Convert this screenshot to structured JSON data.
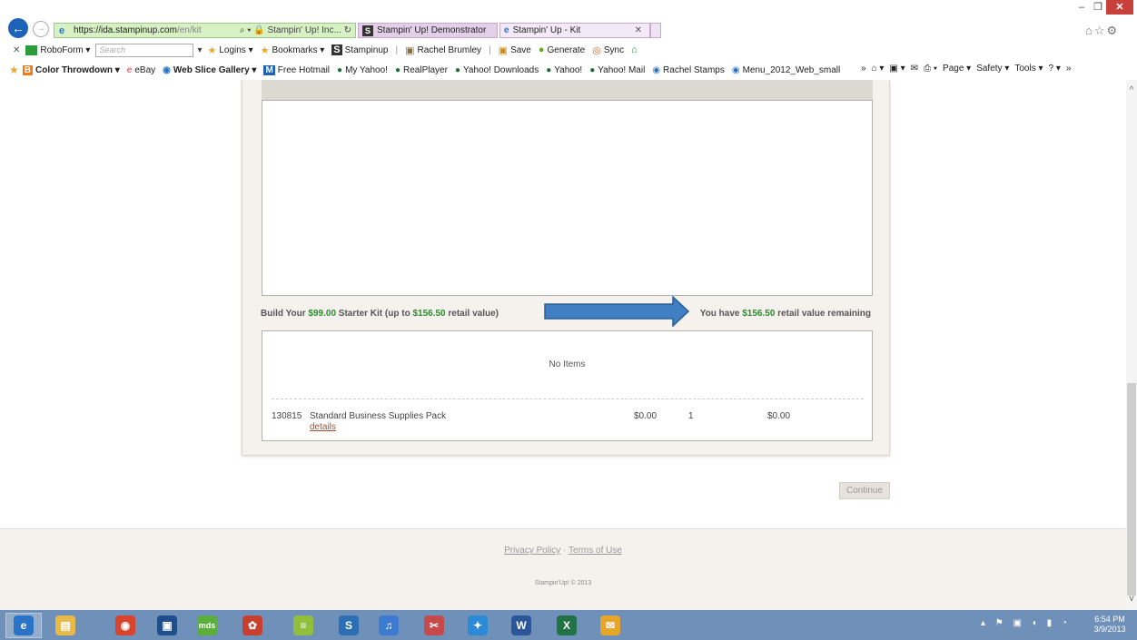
{
  "browser": {
    "window_controls": {
      "minimize": "–",
      "maximize": "❐",
      "close": "✕"
    },
    "address": {
      "host": "https://ida.stampinup.com",
      "path": "/en/kit",
      "tools": "⌕ ▾ 🔒 Stampin' Up! Inc... ↻"
    },
    "tabs": [
      {
        "label": "Stampin' Up! Demonstrator",
        "icon": "stampinup-s-icon",
        "active": false
      },
      {
        "label": "Stampin' Up - Kit",
        "icon": "ie-icon",
        "active": true,
        "close": "✕"
      }
    ],
    "right_icons": "⌂☆⚙",
    "roboform": {
      "close": "✕",
      "brand": "RoboForm ▾",
      "search_placeholder": "Search",
      "items": [
        {
          "label": "Logins ▾",
          "icon": "★"
        },
        {
          "label": "Bookmarks ▾",
          "icon": "★"
        },
        {
          "label": "Stampinup",
          "icon": "S"
        },
        {
          "label": "Rachel Brumley",
          "icon": "▣"
        },
        {
          "label": "Save",
          "icon": "▣"
        },
        {
          "label": "Generate",
          "icon": "●"
        },
        {
          "label": "Sync",
          "icon": "◎"
        },
        {
          "label": "",
          "icon": "⌂"
        }
      ]
    },
    "favorites": [
      {
        "label": "Color Throwdown ▾",
        "icon": "B",
        "bold": true
      },
      {
        "label": "eBay",
        "icon": "e"
      },
      {
        "label": "Web Slice Gallery ▾",
        "icon": "◉",
        "bold": true
      },
      {
        "label": "Free Hotmail",
        "icon": "M"
      },
      {
        "label": "My Yahoo!",
        "icon": "●"
      },
      {
        "label": "RealPlayer",
        "icon": "●"
      },
      {
        "label": "Yahoo! Downloads",
        "icon": "●"
      },
      {
        "label": "Yahoo!",
        "icon": "●"
      },
      {
        "label": "Yahoo! Mail",
        "icon": "●"
      },
      {
        "label": "Rachel Stamps",
        "icon": "◉"
      },
      {
        "label": "Menu_2012_Web_small",
        "icon": "◉"
      }
    ],
    "command_bar": {
      "overflow": "»",
      "home": "⌂ ▾",
      "feeds": "▣ ▾",
      "mail": "✉",
      "print": "⎙ ▾",
      "page": "Page ▾",
      "safety": "Safety ▾",
      "tools": "Tools ▾",
      "help": "? ▾",
      "overflow2": "»"
    }
  },
  "page": {
    "build": {
      "prefix": "Build Your ",
      "price": "$99.00",
      "middle": " Starter Kit (up to ",
      "retail": "$156.50",
      "suffix": " retail value)"
    },
    "remaining": {
      "prefix": "You have ",
      "amount": "$156.50",
      "suffix": " retail value remaining"
    },
    "no_items": "No Items",
    "items": [
      {
        "sku": "130815",
        "name": "Standard Business Supplies Pack",
        "details": "details",
        "price": "$0.00",
        "qty": "1",
        "total": "$0.00"
      }
    ],
    "continue_label": "Continue",
    "footer": {
      "privacy": "Privacy Policy",
      "separator": " · ",
      "terms": "Terms of Use",
      "copyright": "Stampin'Up! © 2013"
    },
    "arrow_color": "#3f7fc2"
  },
  "scrollbar": {
    "up": "^",
    "down": "v"
  },
  "taskbar": {
    "icons": [
      {
        "name": "ie-icon",
        "glyph": "e",
        "color": "#2a73c8",
        "active": true
      },
      {
        "name": "file-explorer-icon",
        "glyph": "▤",
        "color": "#e9b949"
      },
      {
        "name": "chrome-icon",
        "glyph": "◉",
        "color": "#d9442f"
      },
      {
        "name": "app-icon",
        "glyph": "▣",
        "color": "#1e4f8c"
      },
      {
        "name": "mds-icon",
        "glyph": "mds",
        "color": "#5cae3c"
      },
      {
        "name": "picasa-icon",
        "glyph": "✿",
        "color": "#c7402f"
      },
      {
        "name": "notes-icon",
        "glyph": "≡",
        "color": "#8fbf3d"
      },
      {
        "name": "stampinup-icon",
        "glyph": "S",
        "color": "#2c6fb5"
      },
      {
        "name": "itunes-icon",
        "glyph": "♫",
        "color": "#3d7bd0"
      },
      {
        "name": "snipping-tool-icon",
        "glyph": "✂",
        "color": "#c64a4a"
      },
      {
        "name": "twitter-icon",
        "glyph": "✦",
        "color": "#2b8ad6"
      },
      {
        "name": "word-icon",
        "glyph": "W",
        "color": "#2b579a"
      },
      {
        "name": "excel-icon",
        "glyph": "X",
        "color": "#217346"
      },
      {
        "name": "outlook-icon",
        "glyph": "✉",
        "color": "#e6a52b"
      }
    ],
    "tray": "▴ ⚑ ▣ ◖ ▮ ◔",
    "time": "6:54 PM",
    "date": "3/9/2013"
  }
}
